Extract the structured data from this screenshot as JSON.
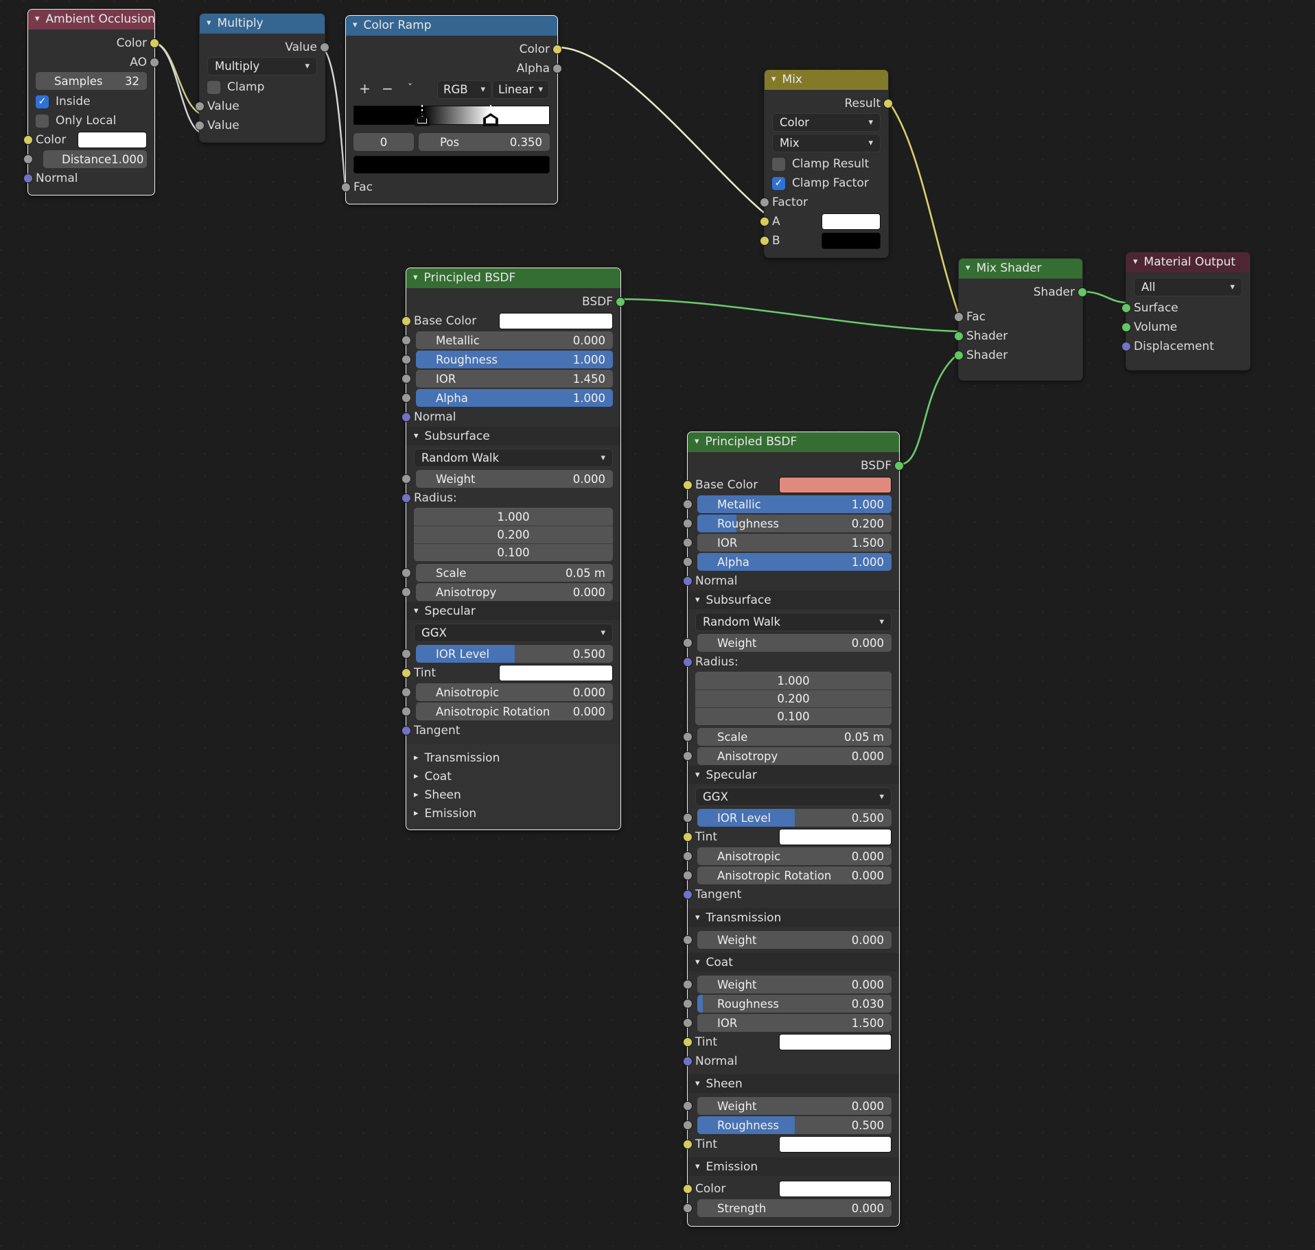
{
  "editor": {
    "name": "blender-shader-node-editor",
    "background": "#1d1d1d"
  },
  "colors": {
    "header_red": "#783a4b",
    "header_blue": "#356591",
    "header_olive": "#837a29",
    "header_green": "#356e33",
    "header_darkred": "#4e2633",
    "slider_blue": "#4772b3",
    "base_color_right": "#e08a7e",
    "white": "#ffffff",
    "black": "#000000"
  },
  "nodes": {
    "ambient_occlusion": {
      "title": "Ambient Occlusion",
      "outputs": [
        {
          "label": "Color",
          "socket": "yellow"
        },
        {
          "label": "AO",
          "socket": "grey"
        }
      ],
      "samples": {
        "label": "Samples",
        "value": "32"
      },
      "inside": {
        "label": "Inside",
        "checked": true
      },
      "only_local": {
        "label": "Only Local",
        "checked": false
      },
      "color": {
        "label": "Color",
        "value": "#ffffff"
      },
      "distance": {
        "label": "Distance",
        "value": "1.000"
      },
      "normal": {
        "label": "Normal"
      }
    },
    "multiply": {
      "title": "Multiply",
      "output": {
        "label": "Value"
      },
      "operation": "Multiply",
      "clamp": {
        "label": "Clamp",
        "checked": false
      },
      "inputs": [
        {
          "label": "Value"
        },
        {
          "label": "Value"
        }
      ]
    },
    "color_ramp": {
      "title": "Color Ramp",
      "outputs": [
        {
          "label": "Color",
          "socket": "yellow"
        },
        {
          "label": "Alpha",
          "socket": "grey"
        }
      ],
      "tools": [
        "+",
        "−",
        "ˇ"
      ],
      "color_mode": "RGB",
      "interpolation": "Linear",
      "index": "0",
      "pos_label": "Pos",
      "pos_value": "0.350",
      "selected_color": "#000000",
      "stops": [
        {
          "position": 0.35,
          "color": "#000000"
        },
        {
          "position": 0.7,
          "color": "#ffffff"
        }
      ],
      "input": {
        "label": "Fac"
      }
    },
    "mix": {
      "title": "Mix",
      "output": {
        "label": "Result"
      },
      "data_type": "Color",
      "blend_mode": "Mix",
      "clamp_result": {
        "label": "Clamp Result",
        "checked": false
      },
      "clamp_factor": {
        "label": "Clamp Factor",
        "checked": true
      },
      "factor": {
        "label": "Factor"
      },
      "a": {
        "label": "A",
        "value": "#ffffff"
      },
      "b": {
        "label": "B",
        "value": "#000000"
      }
    },
    "principled_left": {
      "title": "Principled BSDF",
      "output": {
        "label": "BSDF"
      },
      "base_color": {
        "label": "Base Color",
        "value": "#ffffff"
      },
      "metallic": {
        "label": "Metallic",
        "value": "0.000",
        "fill": 0
      },
      "roughness": {
        "label": "Roughness",
        "value": "1.000",
        "fill": 1
      },
      "ior": {
        "label": "IOR",
        "value": "1.450",
        "fill": 0
      },
      "alpha": {
        "label": "Alpha",
        "value": "1.000",
        "fill": 1
      },
      "normal": {
        "label": "Normal"
      },
      "subsurface": {
        "label": "Subsurface",
        "method": "Random Walk",
        "weight": {
          "label": "Weight",
          "value": "0.000"
        },
        "radius_label": "Radius:",
        "radius": [
          "1.000",
          "0.200",
          "0.100"
        ],
        "scale": {
          "label": "Scale",
          "value": "0.05 m"
        },
        "anisotropy": {
          "label": "Anisotropy",
          "value": "0.000"
        }
      },
      "specular": {
        "label": "Specular",
        "distribution": "GGX",
        "ior_level": {
          "label": "IOR Level",
          "value": "0.500",
          "fill": 0.5
        },
        "tint": {
          "label": "Tint",
          "value": "#ffffff"
        },
        "anisotropic": {
          "label": "Anisotropic",
          "value": "0.000"
        },
        "anisotropic_rotation": {
          "label": "Anisotropic Rotation",
          "value": "0.000"
        },
        "tangent": {
          "label": "Tangent"
        }
      },
      "collapsed": [
        "Transmission",
        "Coat",
        "Sheen",
        "Emission"
      ]
    },
    "principled_right": {
      "title": "Principled BSDF",
      "output": {
        "label": "BSDF"
      },
      "base_color": {
        "label": "Base Color",
        "value": "#e08a7e"
      },
      "metallic": {
        "label": "Metallic",
        "value": "1.000",
        "fill": 1
      },
      "roughness": {
        "label": "Roughness",
        "value": "0.200",
        "fill": 0.2
      },
      "ior": {
        "label": "IOR",
        "value": "1.500",
        "fill": 0
      },
      "alpha": {
        "label": "Alpha",
        "value": "1.000",
        "fill": 1
      },
      "normal": {
        "label": "Normal"
      },
      "subsurface": {
        "label": "Subsurface",
        "method": "Random Walk",
        "weight": {
          "label": "Weight",
          "value": "0.000"
        },
        "radius_label": "Radius:",
        "radius": [
          "1.000",
          "0.200",
          "0.100"
        ],
        "scale": {
          "label": "Scale",
          "value": "0.05 m"
        },
        "anisotropy": {
          "label": "Anisotropy",
          "value": "0.000"
        }
      },
      "specular": {
        "label": "Specular",
        "distribution": "GGX",
        "ior_level": {
          "label": "IOR Level",
          "value": "0.500",
          "fill": 0.5
        },
        "tint": {
          "label": "Tint",
          "value": "#ffffff"
        },
        "anisotropic": {
          "label": "Anisotropic",
          "value": "0.000"
        },
        "anisotropic_rotation": {
          "label": "Anisotropic Rotation",
          "value": "0.000"
        },
        "tangent": {
          "label": "Tangent"
        }
      },
      "transmission": {
        "label": "Transmission",
        "weight": {
          "label": "Weight",
          "value": "0.000"
        }
      },
      "coat": {
        "label": "Coat",
        "weight": {
          "label": "Weight",
          "value": "0.000"
        },
        "roughness": {
          "label": "Roughness",
          "value": "0.030",
          "fill": 0.03
        },
        "ior": {
          "label": "IOR",
          "value": "1.500"
        },
        "tint": {
          "label": "Tint",
          "value": "#ffffff"
        },
        "normal": {
          "label": "Normal"
        }
      },
      "sheen": {
        "label": "Sheen",
        "weight": {
          "label": "Weight",
          "value": "0.000"
        },
        "roughness": {
          "label": "Roughness",
          "value": "0.500",
          "fill": 0.5
        },
        "tint": {
          "label": "Tint",
          "value": "#ffffff"
        }
      },
      "emission": {
        "label": "Emission",
        "color": {
          "label": "Color",
          "value": "#ffffff"
        },
        "strength": {
          "label": "Strength",
          "value": "0.000"
        }
      }
    },
    "mix_shader": {
      "title": "Mix Shader",
      "output": {
        "label": "Shader"
      },
      "inputs": [
        {
          "label": "Fac",
          "socket": "grey"
        },
        {
          "label": "Shader",
          "socket": "green"
        },
        {
          "label": "Shader",
          "socket": "green"
        }
      ]
    },
    "material_output": {
      "title": "Material Output",
      "target": "All",
      "inputs": [
        {
          "label": "Surface",
          "socket": "green"
        },
        {
          "label": "Volume",
          "socket": "green"
        },
        {
          "label": "Displacement",
          "socket": "purple"
        }
      ]
    }
  }
}
